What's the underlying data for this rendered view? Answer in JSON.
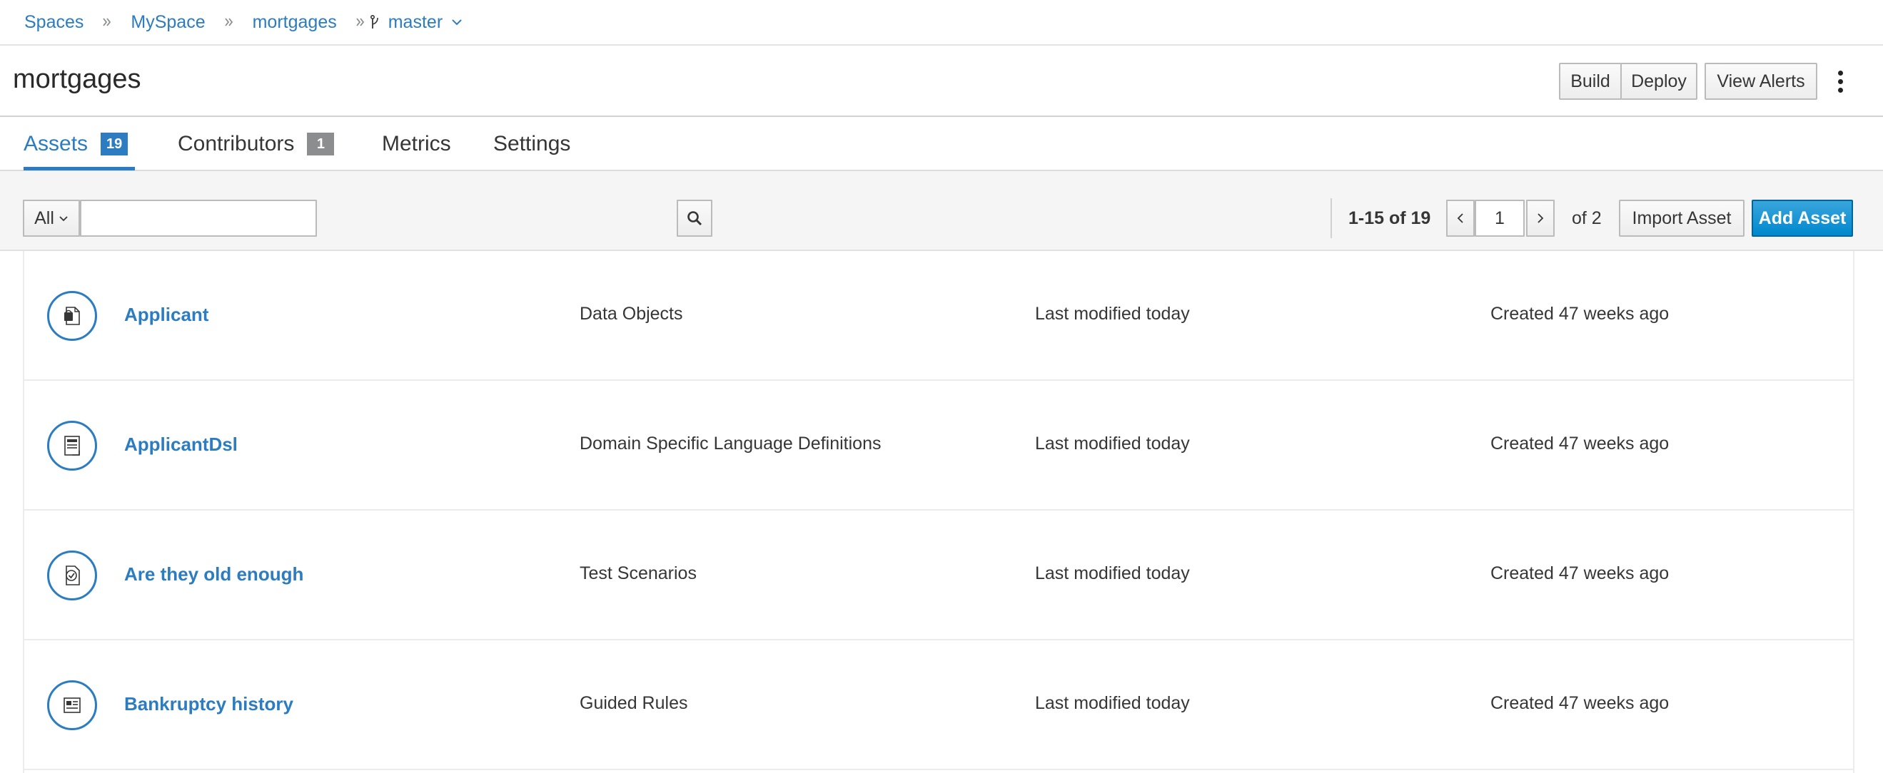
{
  "breadcrumb": {
    "items": [
      "Spaces",
      "MySpace",
      "mortgages"
    ],
    "branch": "master"
  },
  "header": {
    "title": "mortgages",
    "build_label": "Build",
    "deploy_label": "Deploy",
    "view_alerts_label": "View Alerts"
  },
  "tabs": [
    {
      "label": "Assets",
      "badge": "19",
      "active": true
    },
    {
      "label": "Contributors",
      "badge": "1",
      "active": false
    },
    {
      "label": "Metrics",
      "badge": "",
      "active": false
    },
    {
      "label": "Settings",
      "badge": "",
      "active": false
    }
  ],
  "toolbar": {
    "filter_value": "All",
    "search_value": "",
    "range": "1-15 of 19",
    "page": "1",
    "of_pages": "of 2",
    "import_label": "Import Asset",
    "add_label": "Add Asset"
  },
  "assets": [
    {
      "name": "Applicant",
      "type": "Data Objects",
      "modified": "Last modified today",
      "created": "Created 47 weeks ago",
      "icon": "data-object-icon"
    },
    {
      "name": "ApplicantDsl",
      "type": "Domain Specific Language Definitions",
      "modified": "Last modified today",
      "created": "Created 47 weeks ago",
      "icon": "dsl-icon"
    },
    {
      "name": "Are they old enough",
      "type": "Test Scenarios",
      "modified": "Last modified today",
      "created": "Created 47 weeks ago",
      "icon": "test-scenario-icon"
    },
    {
      "name": "Bankruptcy history",
      "type": "Guided Rules",
      "modified": "Last modified today",
      "created": "Created 47 weeks ago",
      "icon": "guided-rule-icon"
    }
  ],
  "colors": {
    "link": "#2b7cc0",
    "primary_button": "#0088ce",
    "toolbar_bg": "#f5f5f5"
  }
}
